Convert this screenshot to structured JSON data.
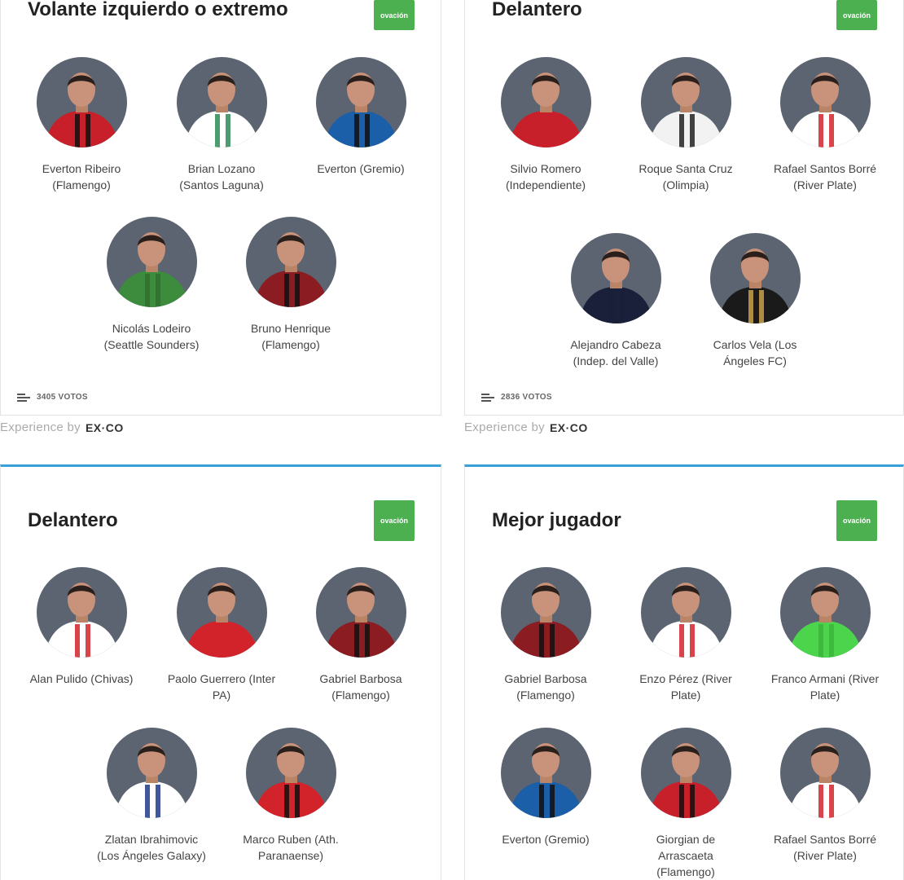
{
  "polls": [
    {
      "title": "Volante izquierdo o extremo",
      "badge": "ovación",
      "votes": "3405 VOTOS",
      "players": [
        {
          "name": "Everton Ribeiro (Flamengo)",
          "jersey": "#c8202a",
          "stripe": "#111111"
        },
        {
          "name": "Brian Lozano (Santos Laguna)",
          "jersey": "#ffffff",
          "stripe": "#2e8b57"
        },
        {
          "name": "Everton (Gremio)",
          "jersey": "#1b5fa8",
          "stripe": "#111111"
        },
        {
          "name": "Nicolás Lodeiro (Seattle Sounders)",
          "jersey": "#3d8b3d",
          "stripe": "#2f6e2f"
        },
        {
          "name": "Bruno Henrique (Flamengo)",
          "jersey": "#8b1c22",
          "stripe": "#111111"
        }
      ]
    },
    {
      "title": "Delantero",
      "badge": "ovación",
      "votes": "2836 VOTOS",
      "players": [
        {
          "name": "Silvio Romero (Independiente)",
          "jersey": "#c8202a",
          "stripe": "#c8202a"
        },
        {
          "name": "Roque Santa Cruz (Olimpia)",
          "jersey": "#f2f2f2",
          "stripe": "#222222"
        },
        {
          "name": "Rafael Santos Borré (River Plate)",
          "jersey": "#ffffff",
          "stripe": "#d2232a"
        },
        {
          "name": "Alejandro Cabeza (Indep. del Valle)",
          "jersey": "#1a1f3a",
          "stripe": "#1a1f3a"
        },
        {
          "name": "Carlos Vela (Los Ángeles FC)",
          "jersey": "#1a1a1a",
          "stripe": "#c9a24a"
        }
      ]
    },
    {
      "title": "Delantero",
      "badge": "ovación",
      "votes": "",
      "players": [
        {
          "name": "Alan Pulido (Chivas)",
          "jersey": "#ffffff",
          "stripe": "#d2232a"
        },
        {
          "name": "Paolo Guerrero (Inter PA)",
          "jersey": "#d2232a",
          "stripe": "#d2232a"
        },
        {
          "name": "Gabriel Barbosa (Flamengo)",
          "jersey": "#8b1c22",
          "stripe": "#111111"
        },
        {
          "name": "Zlatan Ibrahimovic (Los Ángeles Galaxy)",
          "jersey": "#ffffff",
          "stripe": "#1e3a8a"
        },
        {
          "name": "Marco Ruben (Ath. Paranaense)",
          "jersey": "#d2232a",
          "stripe": "#111111"
        }
      ]
    },
    {
      "title": "Mejor jugador",
      "badge": "ovación",
      "votes": "",
      "players": [
        {
          "name": "Gabriel Barbosa (Flamengo)",
          "jersey": "#8b1c22",
          "stripe": "#111111"
        },
        {
          "name": "Enzo Pérez (River Plate)",
          "jersey": "#ffffff",
          "stripe": "#d2232a"
        },
        {
          "name": "Franco Armani (River Plate)",
          "jersey": "#4cd44c",
          "stripe": "#3bb53b"
        },
        {
          "name": "Everton (Gremio)",
          "jersey": "#1b5fa8",
          "stripe": "#111111"
        },
        {
          "name": "Giorgian de Arrascaeta (Flamengo)",
          "jersey": "#c8202a",
          "stripe": "#111111"
        },
        {
          "name": "Rafael Santos Borré (River Plate)",
          "jersey": "#ffffff",
          "stripe": "#d2232a"
        }
      ]
    }
  ],
  "footer": {
    "experience_by": "Experience by",
    "logo": "EX·CO"
  },
  "colors": {
    "badge": "#4caf50",
    "accent": "#3aa1d8"
  }
}
